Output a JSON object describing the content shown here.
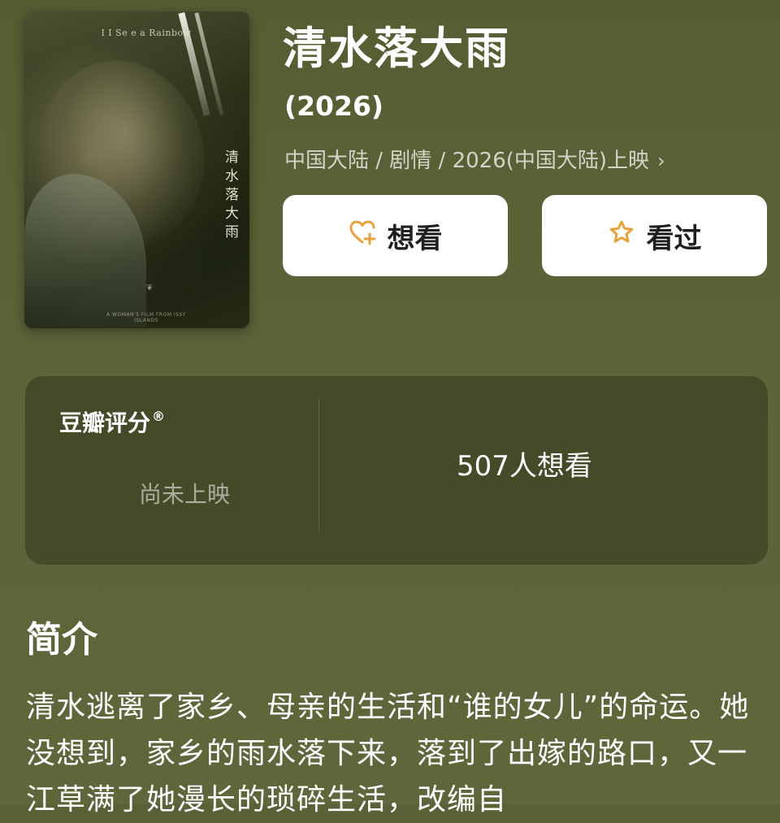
{
  "poster": {
    "top_text": "I I Se e a Rainbow",
    "vertical_title": "清水落大雨",
    "bottom_text": "A WOMAN'S FILM FROM ISSY ISLANDS",
    "laurel_icon": "cannes-laurel-icon"
  },
  "movie": {
    "title": "清水落大雨",
    "year": "(2026)",
    "meta": "中国大陆 / 剧情 / 2026(中国大陆)上映",
    "meta_chevron": "›"
  },
  "actions": {
    "want_label": "想看",
    "seen_label": "看过",
    "want_icon": "heart-plus-icon",
    "seen_icon": "star-icon",
    "icon_color": "#e9a23b"
  },
  "rating": {
    "label": "豆瓣评分",
    "registered_mark": "®",
    "status": "尚未上映",
    "want_count": "507人想看"
  },
  "intro": {
    "heading": "简介",
    "text": "清水逃离了家乡、母亲的生活和“谁的女儿”的命运。她没想到，家乡的雨水落下来，落到了出嫁的路口，又一江草满了她漫长的琐碎生活，改编自"
  },
  "colors": {
    "background": "#5a6137",
    "card": "#3b4121",
    "button_bg": "#ffffff",
    "accent": "#e9a23b"
  }
}
